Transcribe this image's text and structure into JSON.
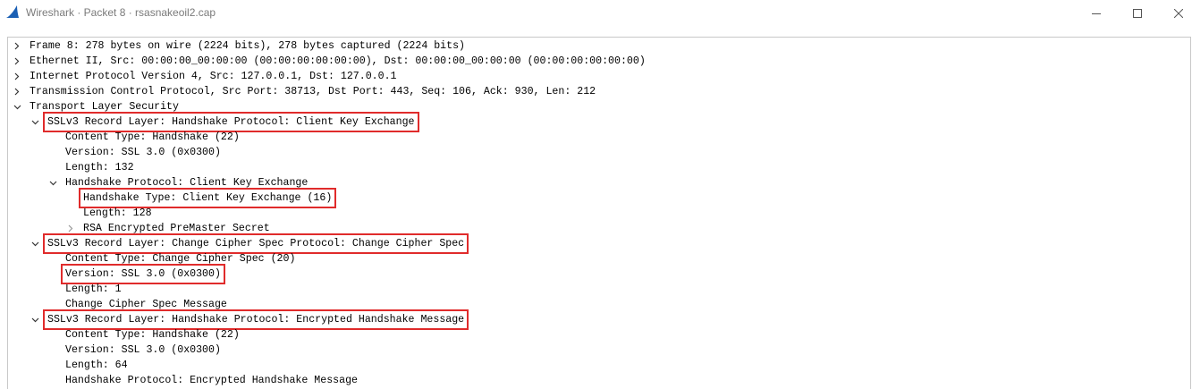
{
  "window": {
    "title": "Wireshark · Packet 8 · rsasnakeoil2.cap",
    "app_icon": "wireshark-fin-icon",
    "controls": [
      "minimize-icon",
      "maximize-icon",
      "close-icon"
    ]
  },
  "accent_colors": {
    "highlight_box": "#e02b2b",
    "app_icon": "#1a5fb4"
  },
  "tree": [
    {
      "text": "Frame 8: 278 bytes on wire (2224 bits), 278 bytes captured (2224 bits)",
      "expander": "collapsed"
    },
    {
      "text": "Ethernet II, Src: 00:00:00_00:00:00 (00:00:00:00:00:00), Dst: 00:00:00_00:00:00 (00:00:00:00:00:00)",
      "expander": "collapsed"
    },
    {
      "text": "Internet Protocol Version 4, Src: 127.0.0.1, Dst: 127.0.0.1",
      "expander": "collapsed"
    },
    {
      "text": "Transmission Control Protocol, Src Port: 38713, Dst Port: 443, Seq: 106, Ack: 930, Len: 212",
      "expander": "collapsed"
    },
    {
      "text": "Transport Layer Security",
      "expander": "expanded"
    },
    {
      "text": "SSLv3 Record Layer: Handshake Protocol: Client Key Exchange",
      "expander": "expanded",
      "highlighted": true
    },
    {
      "text": "Content Type: Handshake (22)",
      "expander": "none"
    },
    {
      "text": "Version: SSL 3.0 (0x0300)",
      "expander": "none"
    },
    {
      "text": "Length: 132",
      "expander": "none"
    },
    {
      "text": "Handshake Protocol: Client Key Exchange",
      "expander": "expanded"
    },
    {
      "text": "Handshake Type: Client Key Exchange (16)",
      "expander": "none",
      "highlighted": true
    },
    {
      "text": "Length: 128",
      "expander": "none"
    },
    {
      "text": "RSA Encrypted PreMaster Secret",
      "expander": "collapsed"
    },
    {
      "text": "SSLv3 Record Layer: Change Cipher Spec Protocol: Change Cipher Spec",
      "expander": "expanded",
      "highlighted": true
    },
    {
      "text": "Content Type: Change Cipher Spec (20)",
      "expander": "none"
    },
    {
      "text": "Version: SSL 3.0 (0x0300)",
      "expander": "none",
      "highlighted": true
    },
    {
      "text": "Length: 1",
      "expander": "none"
    },
    {
      "text": "Change Cipher Spec Message",
      "expander": "none"
    },
    {
      "text": "SSLv3 Record Layer: Handshake Protocol: Encrypted Handshake Message",
      "expander": "expanded",
      "highlighted": true
    },
    {
      "text": "Content Type: Handshake (22)",
      "expander": "none"
    },
    {
      "text": "Version: SSL 3.0 (0x0300)",
      "expander": "none"
    },
    {
      "text": "Length: 64",
      "expander": "none"
    },
    {
      "text": "Handshake Protocol: Encrypted Handshake Message",
      "expander": "none"
    }
  ]
}
